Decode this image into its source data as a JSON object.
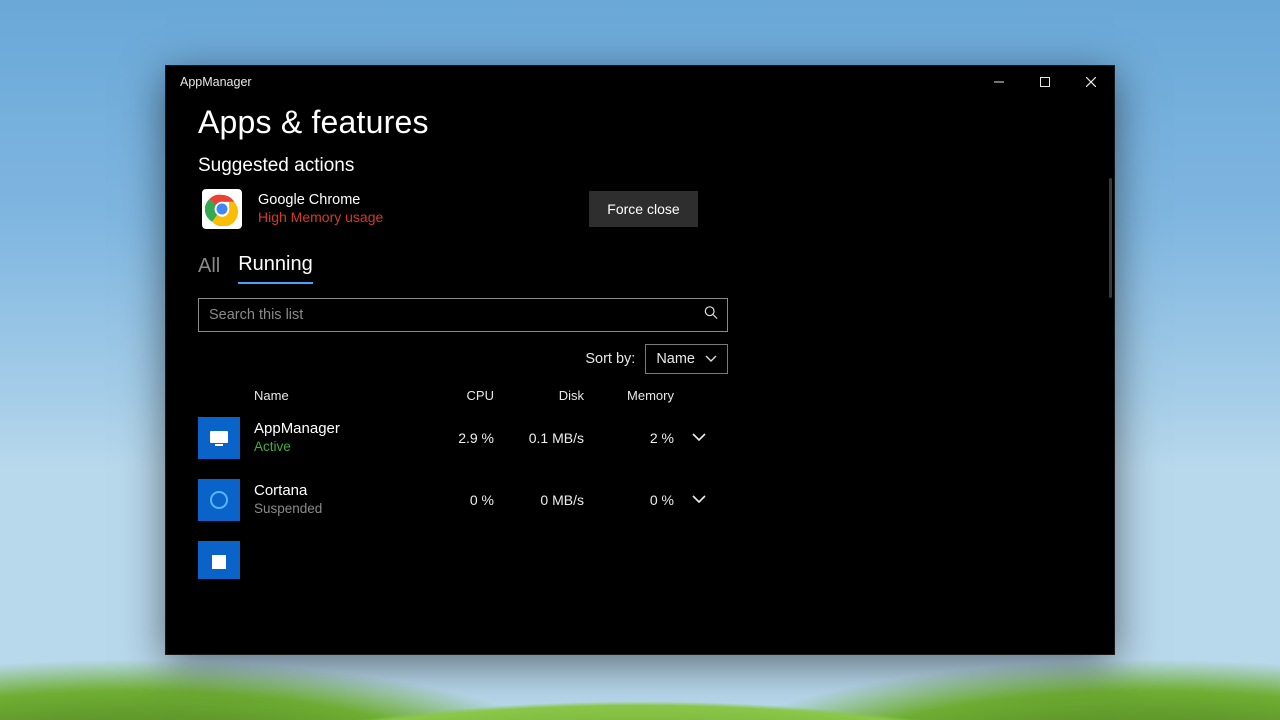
{
  "window": {
    "title": "AppManager"
  },
  "page": {
    "heading": "Apps & features",
    "suggested_heading": "Suggested actions"
  },
  "suggested": {
    "app_name": "Google Chrome",
    "warning": "High Memory usage",
    "action_label": "Force close"
  },
  "tabs": {
    "all": "All",
    "running": "Running",
    "active": "running"
  },
  "search": {
    "placeholder": "Search this list"
  },
  "sort": {
    "label": "Sort by:",
    "selected": "Name"
  },
  "columns": {
    "name": "Name",
    "cpu": "CPU",
    "disk": "Disk",
    "memory": "Memory"
  },
  "rows": [
    {
      "name": "AppManager",
      "status": "Active",
      "status_kind": "active",
      "cpu": "2.9 %",
      "disk": "0.1 MB/s",
      "mem": "2 %"
    },
    {
      "name": "Cortana",
      "status": "Suspended",
      "status_kind": "suspended",
      "cpu": "0 %",
      "disk": "0 MB/s",
      "mem": "0 %"
    }
  ]
}
